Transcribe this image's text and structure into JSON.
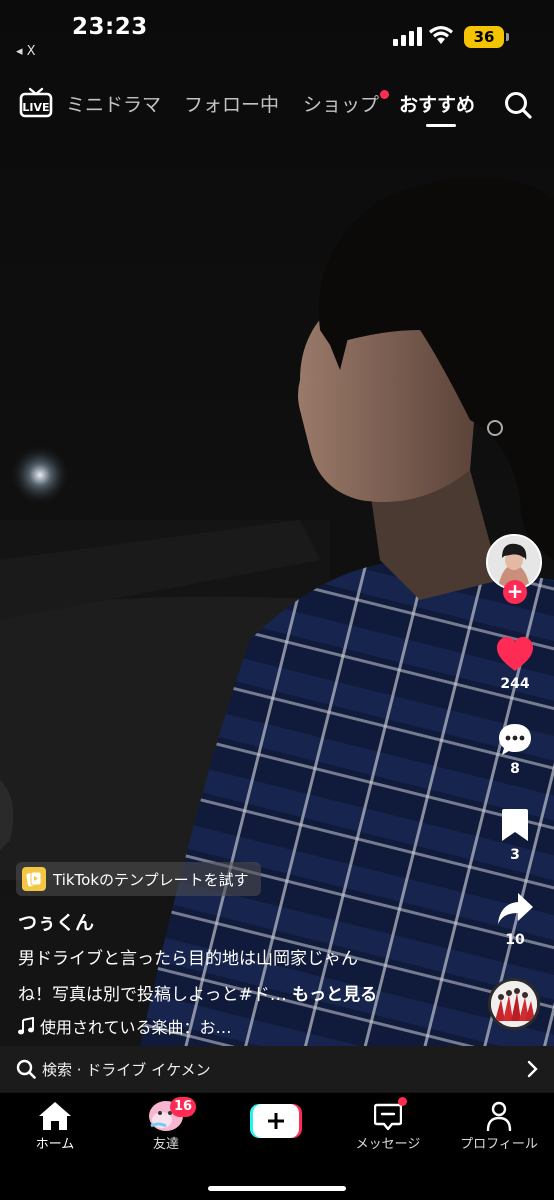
{
  "status_bar": {
    "time": "23:23",
    "back_label": "◂ X",
    "battery": "36"
  },
  "top_nav": {
    "live_label": "LIVE",
    "tabs": [
      {
        "label": "ミニドラマ",
        "active": false
      },
      {
        "label": "フォロー中",
        "active": false
      },
      {
        "label": "ショップ",
        "active": false,
        "dot": true
      },
      {
        "label": "おすすめ",
        "active": true
      }
    ]
  },
  "actions": {
    "likes": "244",
    "comments": "8",
    "bookmarks": "3",
    "shares": "10"
  },
  "video": {
    "template_chip": "TikTokのテンプレートを試す",
    "author": "つぅくん",
    "caption_line1": "男ドライブと言ったら目的地は山岡家じゃん",
    "caption_line2": "ね！写真は別で投稿しよっと#ド…",
    "more_label": "もっと見る",
    "music": "使用されている楽曲：お…"
  },
  "search_bar": {
    "text": "検索 · ドライブ イケメン"
  },
  "bottom_nav": {
    "items": [
      {
        "label": "ホーム",
        "icon": "home-icon"
      },
      {
        "label": "友達",
        "icon": "friends-icon"
      },
      {
        "label": "",
        "icon": "create-icon"
      },
      {
        "label": "メッセージ",
        "icon": "inbox-icon"
      },
      {
        "label": "プロフィール",
        "icon": "profile-icon"
      }
    ],
    "friends_badge": "16"
  },
  "colors": {
    "accent": "#fe2c55",
    "battery": "#f5c400",
    "cyan": "#25f4ee"
  }
}
